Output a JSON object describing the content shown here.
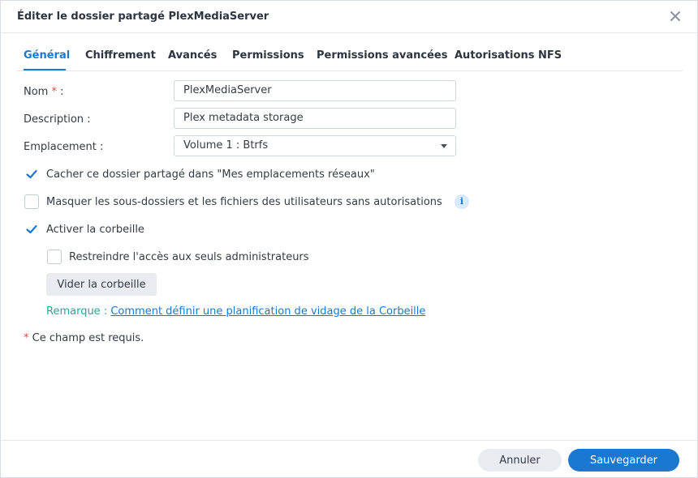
{
  "dialog": {
    "title": "Éditer le dossier partagé PlexMediaServer"
  },
  "tabs": [
    {
      "label": "Général",
      "active": true
    },
    {
      "label": "Chiffrement",
      "active": false
    },
    {
      "label": "Avancés",
      "active": false
    },
    {
      "label": "Permissions",
      "active": false
    },
    {
      "label": "Permissions avancées",
      "active": false
    },
    {
      "label": "Autorisations NFS",
      "active": false
    }
  ],
  "form": {
    "name_label": "Nom",
    "required_mark": "*",
    "colon": ":",
    "name_value": "PlexMediaServer",
    "description_label": "Description :",
    "description_value": "Plex metadata storage",
    "location_label": "Emplacement :",
    "location_value": "Volume 1 :  Btrfs"
  },
  "options": {
    "hide_share": {
      "label": "Cacher ce dossier partagé dans \"Mes emplacements réseaux\"",
      "checked": true
    },
    "hide_subfolders": {
      "label": "Masquer les sous-dossiers et les fichiers des utilisateurs sans autorisations",
      "checked": false
    },
    "recycle_bin": {
      "label": "Activer la corbeille",
      "checked": true
    },
    "restrict_admin": {
      "label": "Restreindre l'accès aux seuls administrateurs",
      "checked": false
    }
  },
  "empty_bin_label": "Vider la corbeille",
  "note": {
    "key": "Remarque :",
    "link": "Comment définir une planification de vidage de la Corbeille"
  },
  "required_note": "Ce champ est requis.",
  "footer": {
    "cancel_label": "Annuler",
    "save_label": "Sauvegarder"
  },
  "colors": {
    "accent": "#1b78d1",
    "required": "#e4483f",
    "note": "#23a6a1"
  },
  "icons": {
    "close": "close-icon",
    "check": "check-icon",
    "info": "info-icon",
    "dropdown": "chevron-down-icon"
  }
}
